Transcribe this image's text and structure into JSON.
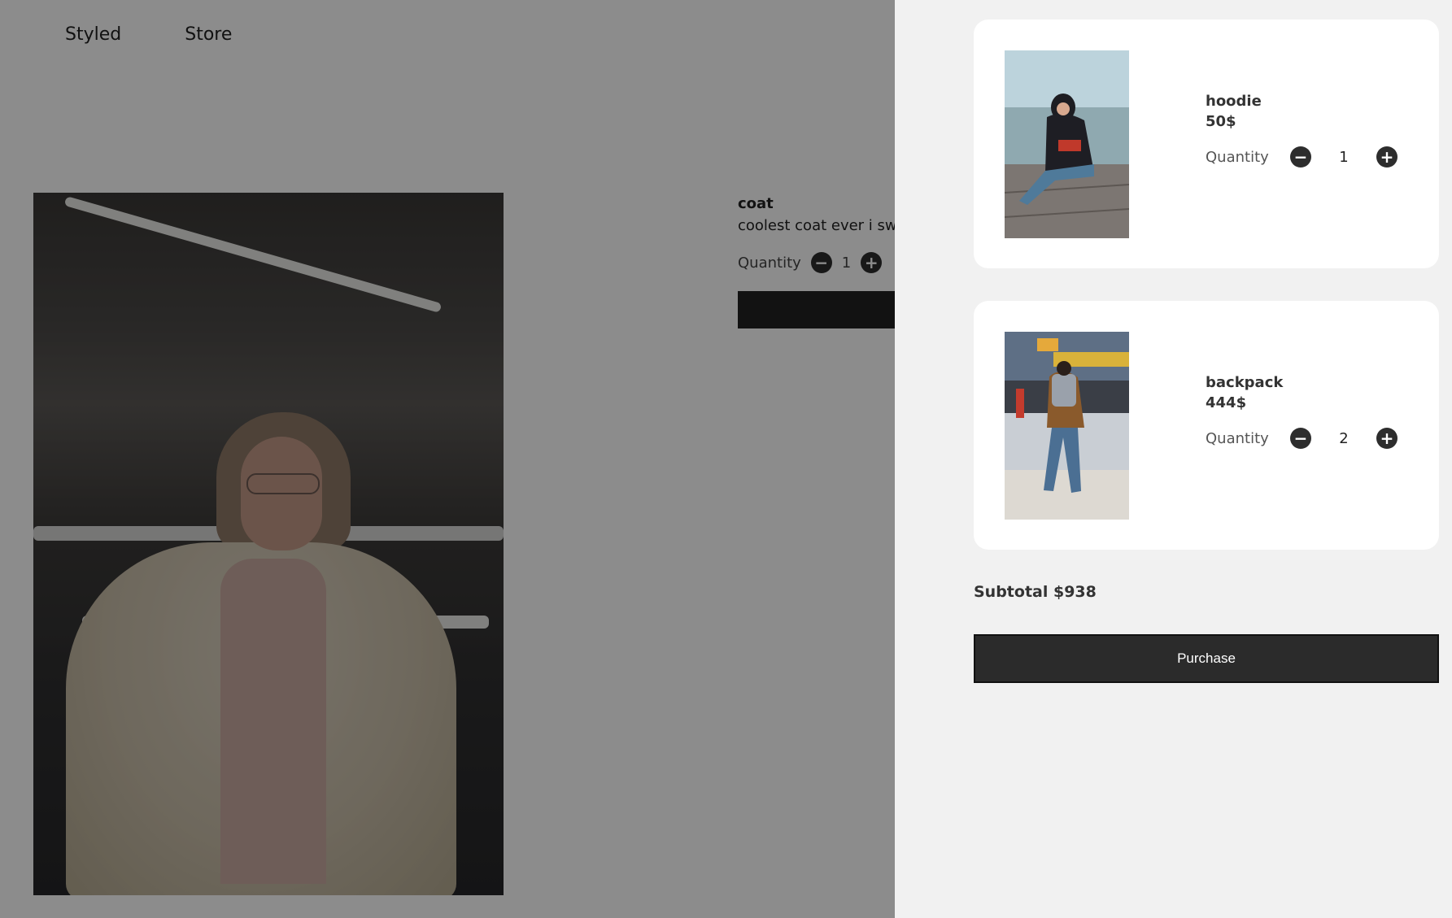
{
  "nav": {
    "brand": "Styled",
    "store": "Store"
  },
  "product": {
    "name": "coat",
    "description": "coolest coat ever i swea",
    "quantity_label": "Quantity",
    "quantity": "1",
    "minus": "−",
    "plus": "+"
  },
  "cart": {
    "items": [
      {
        "name": "hoodie",
        "price": "50$",
        "quantity_label": "Quantity",
        "quantity": "1",
        "minus": "−",
        "plus": "+"
      },
      {
        "name": "backpack",
        "price": "444$",
        "quantity_label": "Quantity",
        "quantity": "2",
        "minus": "−",
        "plus": "+"
      }
    ],
    "subtotal": "Subtotal $938",
    "purchase_label": "Purchase"
  },
  "colors": {
    "overlay": "#8d8d8d",
    "drawer": "#f1f1f1",
    "button": "#2b2b2b"
  },
  "icons": [
    "minus-circle-icon",
    "plus-circle-icon"
  ]
}
